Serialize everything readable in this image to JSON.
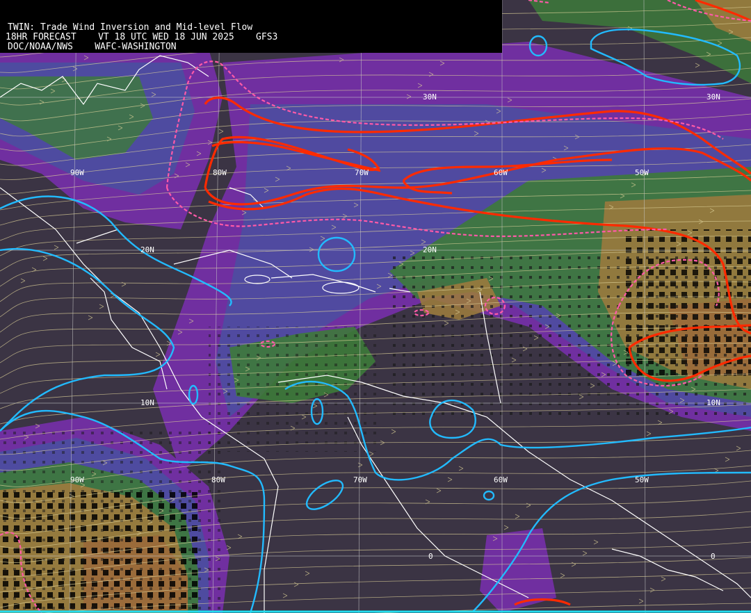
{
  "header": {
    "title": "TWIN: Trade Wind Inversion and Mid-level Flow",
    "forecast": "18HR FORECAST",
    "valid_time": "VT 18 UTC WED 18 JUN 2025",
    "model": "GFS3",
    "agency": "DOC/NOAA/NWS",
    "center": "WAFC-WASHINGTON"
  },
  "grid": {
    "lat_labels": [
      "30N",
      "30N",
      "20N",
      "20N",
      "10N",
      "10N",
      "0",
      "0"
    ],
    "lon_labels": [
      "90W",
      "80W",
      "70W",
      "60W",
      "50W",
      "90W",
      "80W",
      "70W",
      "60W",
      "50W"
    ]
  },
  "colors": {
    "background": "#3b3444",
    "purple_band": "#7a2fb0",
    "blue_band": "#4a4fa0",
    "green_band": "#3d7a3a",
    "tan_band": "#9a7a3e",
    "brown_band": "#9a6a3a",
    "streamline": "#e0d49a",
    "cyan_contour": "#22bbff",
    "red_contour": "#ff2a00",
    "pink_dashed": "#ff5aa8",
    "coastline": "#ffffff"
  }
}
